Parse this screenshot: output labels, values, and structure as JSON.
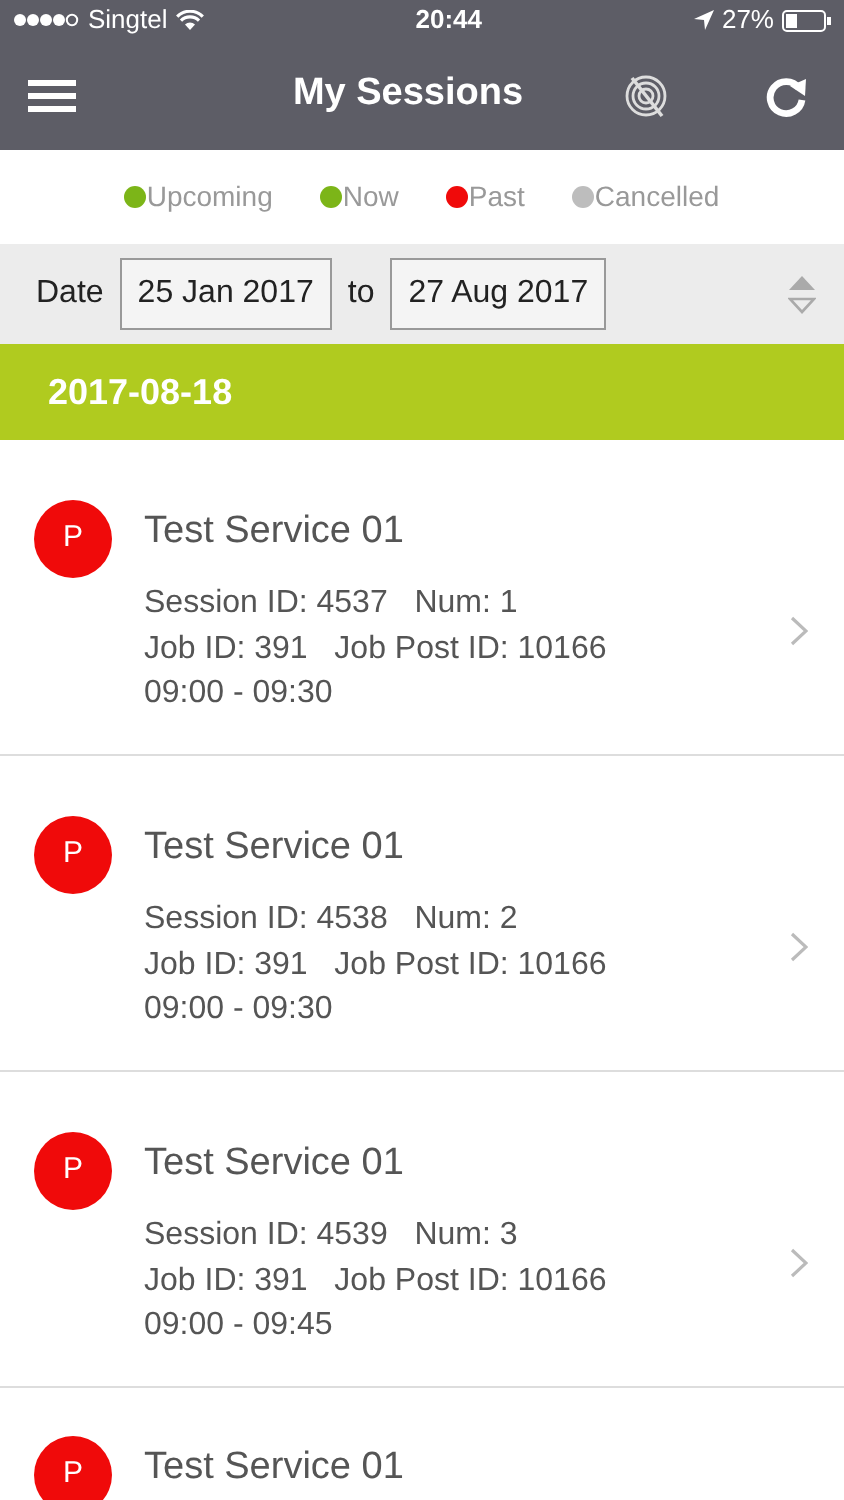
{
  "status_bar": {
    "carrier": "Singtel",
    "time": "20:44",
    "battery": "27%"
  },
  "header": {
    "title": "My Sessions"
  },
  "legend": [
    {
      "label": "Upcoming",
      "color": "#7cb518"
    },
    {
      "label": "Now",
      "color": "#7cb518"
    },
    {
      "label": "Past",
      "color": "#f00a0a"
    },
    {
      "label": "Cancelled",
      "color": "#bdbdbd"
    }
  ],
  "date_filter": {
    "label": "Date",
    "from": "25 Jan 2017",
    "separator": "to",
    "to": "27 Aug 2017"
  },
  "groups": [
    {
      "date": "2017-08-18",
      "sessions": [
        {
          "badge": "P",
          "color": "#f00a0a",
          "title": "Test Service 01",
          "lines": [
            "Session ID: 4537   Num: 1",
            "Job ID: 391   Job Post ID: 10166",
            "09:00 - 09:30"
          ]
        },
        {
          "badge": "P",
          "color": "#f00a0a",
          "title": "Test Service 01",
          "lines": [
            "Session ID: 4538   Num: 2",
            "Job ID: 391   Job Post ID: 10166",
            "09:00 - 09:30"
          ]
        },
        {
          "badge": "P",
          "color": "#f00a0a",
          "title": "Test Service 01",
          "lines": [
            "Session ID: 4539   Num: 3",
            "Job ID: 391   Job Post ID: 10166",
            "09:00 - 09:45"
          ]
        },
        {
          "badge": "P",
          "color": "#f00a0a",
          "title": "Test Service 01"
        }
      ]
    }
  ]
}
